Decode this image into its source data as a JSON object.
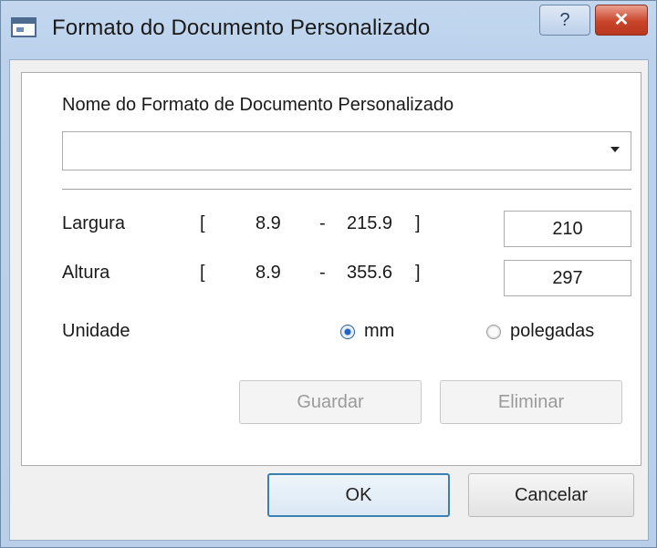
{
  "window": {
    "title": "Formato do Documento Personalizado",
    "help_label": "?",
    "close_label": "✕"
  },
  "form": {
    "name_label": "Nome do Formato de Documento Personalizado",
    "name_value": "",
    "width": {
      "label": "Largura",
      "bracket_open": "[",
      "min": "8.9",
      "dash": "-",
      "max": "215.9",
      "bracket_close": "]",
      "value": "210"
    },
    "height": {
      "label": "Altura",
      "bracket_open": "[",
      "min": "8.9",
      "dash": "-",
      "max": "355.6",
      "bracket_close": "]",
      "value": "297"
    },
    "unit_label": "Unidade",
    "units": [
      {
        "label": "mm",
        "selected": true
      },
      {
        "label": "polegadas",
        "selected": false
      }
    ],
    "save_label": "Guardar",
    "delete_label": "Eliminar"
  },
  "footer": {
    "ok_label": "OK",
    "cancel_label": "Cancelar"
  },
  "colors": {
    "accent": "#1f62c4",
    "close": "#c9442b",
    "titlebar": "#bcd2ec"
  }
}
